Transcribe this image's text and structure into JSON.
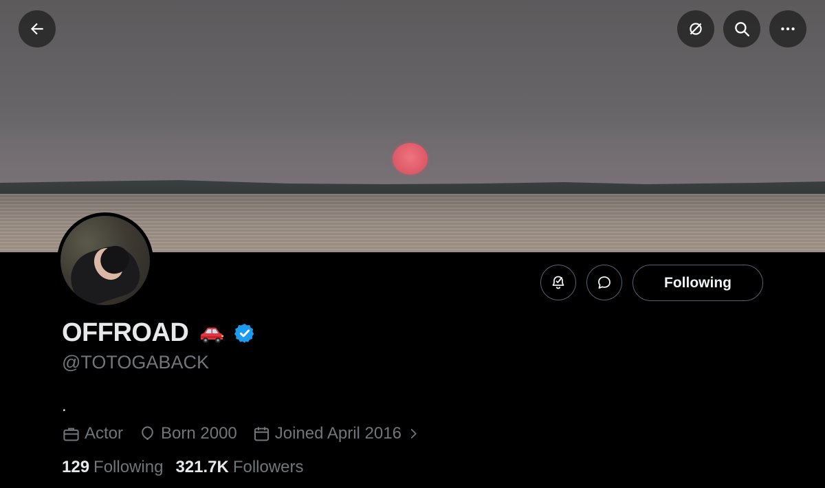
{
  "profile": {
    "display_name": "OFFROAD",
    "handle": "@TOTOGABACK",
    "bio": ".",
    "verified": true,
    "name_emoji": "red-car-emoji",
    "avatar_alt": "profile photo"
  },
  "header_actions": {
    "back": "back-arrow-icon",
    "translate": "translate-off-icon",
    "search": "search-icon",
    "more": "more-icon"
  },
  "actions": {
    "following_label": "Following"
  },
  "meta": {
    "profession": "Actor",
    "born": "Born 2000",
    "joined": "Joined April 2016"
  },
  "stats": {
    "following_count": "129",
    "following_label": "Following",
    "followers_count": "321.7K",
    "followers_label": "Followers"
  },
  "colors": {
    "background": "#000000",
    "text_primary": "#e7e9ea",
    "text_secondary": "#71767b",
    "border": "#536471",
    "verified_blue": "#1d9bf0"
  }
}
